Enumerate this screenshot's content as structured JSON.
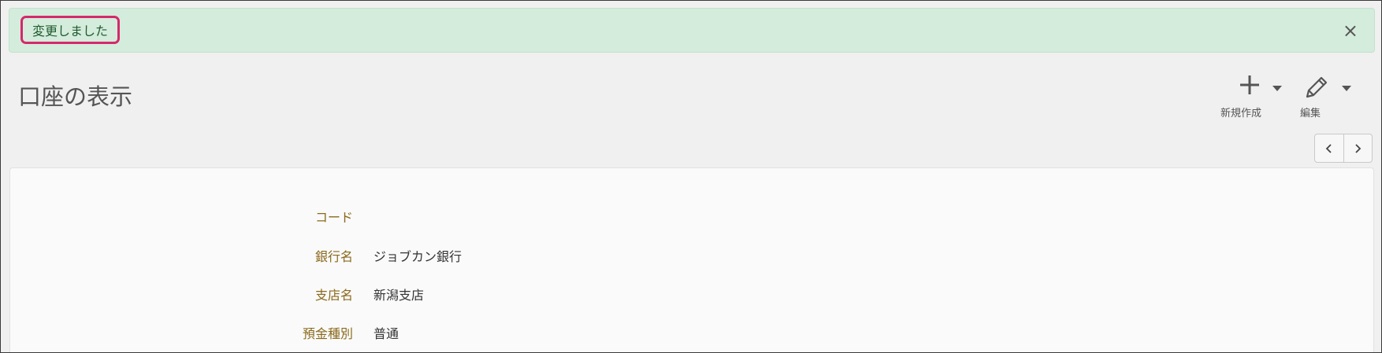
{
  "alert": {
    "message": "変更しました",
    "close_symbol": "×"
  },
  "page": {
    "title": "口座の表示"
  },
  "toolbar": {
    "new_label": "新規作成",
    "new_icon": "plus-icon",
    "edit_label": "編集",
    "edit_icon": "pencil-icon"
  },
  "pager": {
    "prev_icon": "chevron-left-icon",
    "next_icon": "chevron-right-icon"
  },
  "fields": [
    {
      "label": "コード",
      "value": ""
    },
    {
      "label": "銀行名",
      "value": "ジョブカン銀行"
    },
    {
      "label": "支店名",
      "value": "新潟支店"
    },
    {
      "label": "預金種別",
      "value": "普通"
    }
  ],
  "colors": {
    "alert_bg": "#d4ecdc",
    "highlight": "#d4296b",
    "label_text": "#8a6a1c"
  }
}
